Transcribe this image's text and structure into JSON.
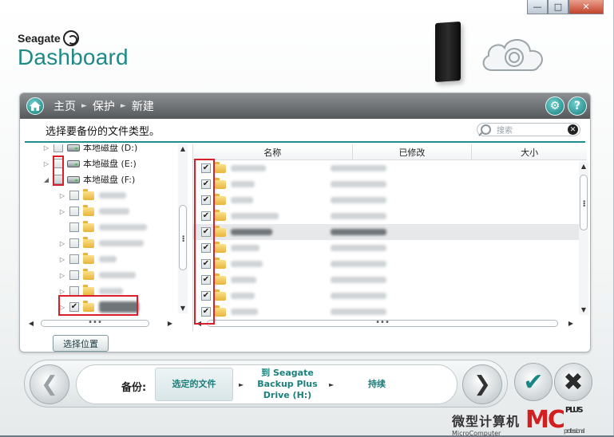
{
  "window": {
    "minimize_icon": "minimize-icon",
    "maximize_icon": "maximize-icon",
    "close_icon": "close-icon"
  },
  "brand": {
    "company": "Seagate",
    "product": "Dashboard"
  },
  "breadcrumb": {
    "items": [
      "主页",
      "保护",
      "新建"
    ]
  },
  "subheader": {
    "instruction": "选择要备份的文件类型。",
    "search_placeholder": "搜索"
  },
  "tree": {
    "drives": [
      {
        "label": "本地磁盘 (D:)"
      },
      {
        "label": "本地磁盘 (E:)"
      },
      {
        "label": "本地磁盘 (F:)"
      }
    ]
  },
  "file_list": {
    "columns": [
      "名称",
      "已修改",
      "大小"
    ]
  },
  "buttons": {
    "choose_location": "选择位置"
  },
  "wizard": {
    "label": "备份:",
    "steps": [
      "选定的文件",
      "到 Seagate Backup Plus Drive (H:)",
      "持续"
    ]
  },
  "watermark": {
    "cn": "微型计算机",
    "mc": "MC",
    "plus": "PLUS",
    "sub": "MicroComputer",
    "sub2": "professional"
  },
  "colors": {
    "accent": "#1d8a86",
    "header_bar": "#55595c",
    "highlight_box": "#d9202a"
  }
}
